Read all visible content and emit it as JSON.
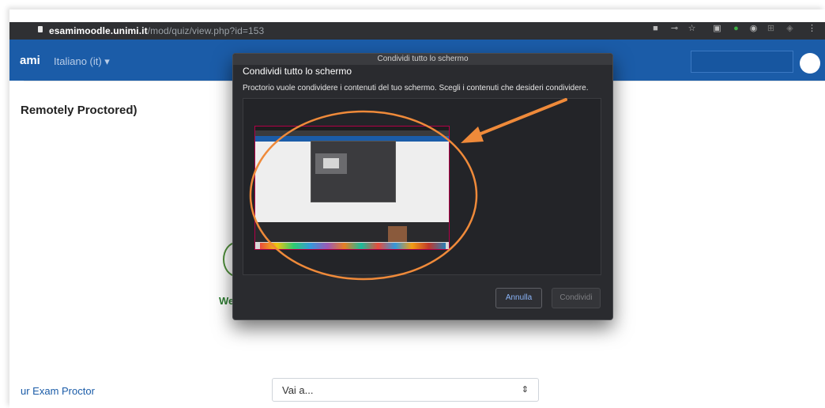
{
  "browser": {
    "url_host": "esamimoodle.unimi.it",
    "url_path": "/mod/quiz/view.php?id=153"
  },
  "navbar": {
    "brand": "ami",
    "language": "Italiano (it) ▾"
  },
  "page": {
    "heading": "Remotely Proctored)",
    "fragment_text": "We",
    "exam_proctor_link": "ur Exam Proctor",
    "jump_select": "Vai a...",
    "jump_select_arrow": "⇕"
  },
  "dialog": {
    "titlebar": "Condividi tutto lo schermo",
    "heading": "Condividi tutto lo schermo",
    "description": "Proctorio vuole condividere i contenuti del tuo schermo. Scegli i contenuti che desideri condividere.",
    "cancel_label": "Annulla",
    "share_label": "Condividi"
  },
  "annotation": {
    "color": "#ef8a3a",
    "shapes": [
      "arrow",
      "ellipse"
    ]
  },
  "icons": [
    "lock-icon",
    "camera-icon",
    "key-icon",
    "star-icon",
    "extension-icon",
    "shield-icon",
    "menu-icon"
  ],
  "colors": {
    "navbar": "#1b5ca8",
    "dialog": "#2a2b2f",
    "accent_link": "#8ab4f8"
  }
}
